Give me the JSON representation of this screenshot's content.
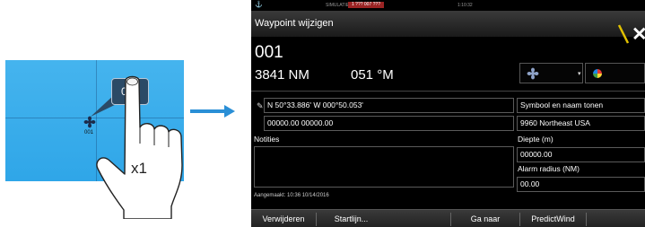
{
  "illustration": {
    "waypoint_label": "001",
    "bubble_label": "001",
    "tap_count": "x1"
  },
  "status": {
    "simulate_text": "SIMULATIE...",
    "badge_text": "1 ??? 007 ???",
    "time_text": "1:10:32"
  },
  "dialog": {
    "title": "Waypoint wijzigen",
    "name": "001",
    "distance": "3841 NM",
    "bearing": "051 °M",
    "position": "N 50°33.886'  W 000°50.053'",
    "grid": "00000.00  00000.00",
    "symbol_option": "Symbool en naam tonen",
    "tide_station": "9960 Northeast USA",
    "notes_label": "Notities",
    "notes_value": "",
    "depth_label": "Diepte (m)",
    "depth_value": "00000.00",
    "alarm_label": "Alarm radius (NM)",
    "alarm_value": "00.00",
    "created": "Aangemaakt: 10:36  10/14/2016"
  },
  "softkeys": [
    "Verwijderen",
    "Startlijn...",
    "Ga naar",
    "PredictWind"
  ],
  "icons": {
    "waypoint": "waypoint-symbol-icon",
    "confirm": "confirm-slash-icon",
    "close": "close-icon",
    "edit": "pencil-icon",
    "color": "color-wheel-icon"
  },
  "colors": {
    "map_water": "#2fa6e8",
    "screen_bg": "#000000",
    "confirm_accent": "#e0c000",
    "arrow": "#2a8fd6"
  }
}
